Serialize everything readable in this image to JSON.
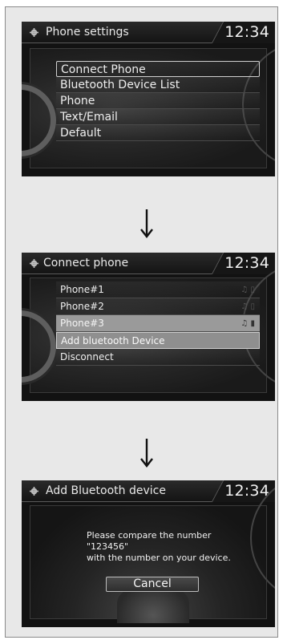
{
  "screens": [
    {
      "title": "Phone settings",
      "clock": "12:34",
      "items": [
        "Connect Phone",
        "Bluetooth Device List",
        "Phone",
        "Text/Email",
        "Default"
      ]
    },
    {
      "title": "Connect phone",
      "clock": "12:34",
      "items": [
        "Phone#1",
        "Phone#2",
        "Phone#3",
        "Add bluetooth Device",
        "Disconnect"
      ]
    },
    {
      "title": "Add Bluetooth device",
      "clock": "12:34",
      "message_line1": "Please compare the number",
      "message_line2": "\"123456\"",
      "message_line3": "with the number on your device.",
      "cancel_label": "Cancel"
    }
  ],
  "colors": {
    "frame_bg": "#e8e8e8",
    "screen_bg": "#121212",
    "text": "#efefef"
  },
  "icons": [
    "gear-icon",
    "down-arrow-icon",
    "music-icon",
    "phone-icon"
  ]
}
